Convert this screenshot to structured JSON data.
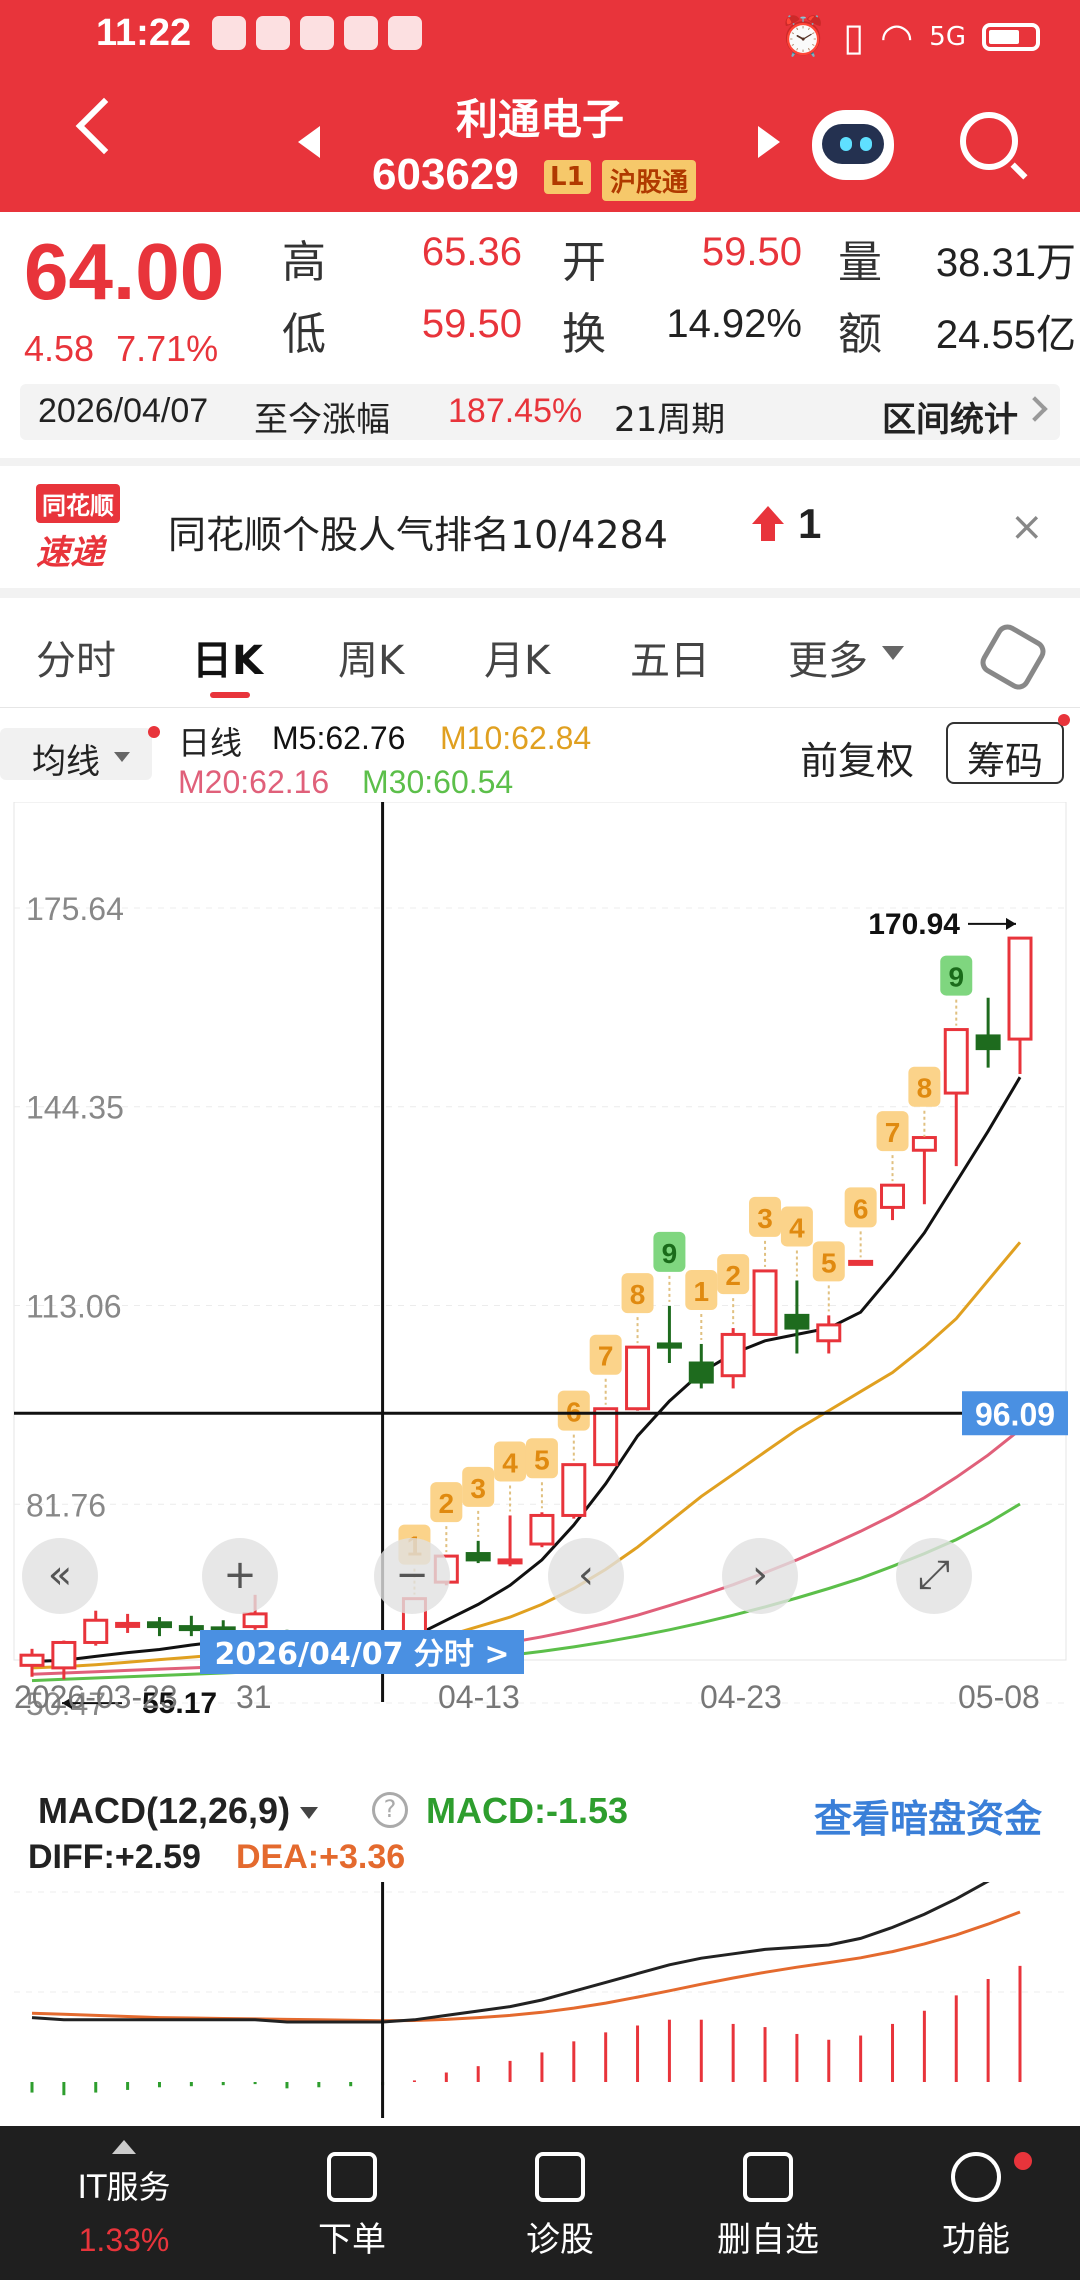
{
  "status": {
    "time": "11:22",
    "network": "5G"
  },
  "header": {
    "name": "利通电子",
    "code": "603629",
    "level_badge": "L1",
    "market_badge": "沪股通"
  },
  "quote": {
    "price": "64.00",
    "change": "4.58",
    "change_pct": "7.71%",
    "high_label": "高",
    "high": "65.36",
    "open_label": "开",
    "open": "59.50",
    "volume_label": "量",
    "volume": "38.31万",
    "low_label": "低",
    "low": "59.50",
    "turnover_label": "换",
    "turnover": "14.92%",
    "amount_label": "额",
    "amount": "24.55亿"
  },
  "stat_bar": {
    "date": "2026/04/07",
    "since_label": "至今涨幅",
    "since_pct": "187.45%",
    "period": "21周期",
    "range_label": "区间统计"
  },
  "rank": {
    "logo_top": "同花顺",
    "logo_bottom": "速递",
    "text": "同花顺个股人气排名10/4284",
    "delta": "1",
    "close": "×"
  },
  "tabs": [
    {
      "label": "分时"
    },
    {
      "label": "日K"
    },
    {
      "label": "周K"
    },
    {
      "label": "月K"
    },
    {
      "label": "五日"
    },
    {
      "label": "更多"
    }
  ],
  "chart_header": {
    "ma_button": "均线",
    "day_line": "日线",
    "m5": "M5:62.76",
    "m10": "M10:62.84",
    "m20": "M20:62.16",
    "m30": "M30:60.54",
    "fuquan": "前复权",
    "chouma": "筹码"
  },
  "colors": {
    "up": "#e8343b",
    "down": "#1e6b1e",
    "m5": "#111111",
    "m10": "#e0a020",
    "m20": "#e0607a",
    "m30": "#5cbf4a",
    "accent_blue": "#3a7fd8"
  },
  "chart_data": {
    "type": "candlestick",
    "y_ticks": [
      "175.64",
      "144.35",
      "113.06",
      "81.76",
      "50.47"
    ],
    "ylim": [
      50.47,
      175.64
    ],
    "x_ticks": [
      "2026-03-23",
      "31",
      "04-13",
      "04-23",
      "05-08"
    ],
    "max_label": "170.94",
    "min_label": "55.17",
    "crosshair_price": "96.09",
    "crosshair_date": "2026/04/07 分时 >",
    "candles": [
      {
        "o": 56.4,
        "h": 59.0,
        "l": 54.6,
        "c": 58.0
      },
      {
        "o": 56.0,
        "h": 60.3,
        "l": 54.2,
        "c": 60.0
      },
      {
        "o": 60.0,
        "h": 65.0,
        "l": 59.5,
        "c": 63.5
      },
      {
        "o": 63.0,
        "h": 64.5,
        "l": 61.5,
        "c": 63.0
      },
      {
        "o": 63.1,
        "h": 64.0,
        "l": 61.0,
        "c": 62.5
      },
      {
        "o": 62.5,
        "h": 64.2,
        "l": 61.0,
        "c": 62.3
      },
      {
        "o": 62.3,
        "h": 63.5,
        "l": 61.0,
        "c": 62.1
      },
      {
        "o": 62.5,
        "h": 67.5,
        "l": 62.0,
        "c": 64.5
      },
      {
        "o": 60.8,
        "h": 62.0,
        "l": 58.5,
        "c": 59.2
      },
      {
        "o": 59.5,
        "h": 60.5,
        "l": 57.5,
        "c": 58.8
      },
      {
        "o": 59.5,
        "h": 61.5,
        "l": 57.5,
        "c": 61.0
      },
      {
        "o": 55.5,
        "h": 62.0,
        "l": 55.2,
        "c": 60.5
      },
      {
        "o": 60.5,
        "h": 66.9,
        "l": 60.5,
        "c": 66.9
      },
      {
        "o": 69.5,
        "h": 73.6,
        "l": 69.0,
        "c": 73.6
      },
      {
        "o": 74.0,
        "h": 76.0,
        "l": 72.5,
        "c": 73.0
      },
      {
        "o": 73.0,
        "h": 80.0,
        "l": 72.0,
        "c": 73.0
      },
      {
        "o": 75.5,
        "h": 80.5,
        "l": 75.0,
        "c": 80.0
      },
      {
        "o": 80.0,
        "h": 88.0,
        "l": 79.5,
        "c": 88.0
      },
      {
        "o": 88.0,
        "h": 96.8,
        "l": 88.0,
        "c": 96.8
      },
      {
        "o": 96.8,
        "h": 106.5,
        "l": 96.5,
        "c": 106.5
      },
      {
        "o": 107.0,
        "h": 113.0,
        "l": 104.0,
        "c": 106.5
      },
      {
        "o": 104.0,
        "h": 107.0,
        "l": 100.0,
        "c": 101.0
      },
      {
        "o": 102.0,
        "h": 109.5,
        "l": 100.0,
        "c": 108.5
      },
      {
        "o": 108.5,
        "h": 118.5,
        "l": 108.5,
        "c": 118.5
      },
      {
        "o": 111.5,
        "h": 117.0,
        "l": 105.5,
        "c": 109.5
      },
      {
        "o": 107.5,
        "h": 111.5,
        "l": 105.5,
        "c": 110.0
      },
      {
        "o": 120.0,
        "h": 120.0,
        "l": 120.0,
        "c": 120.0
      },
      {
        "o": 128.5,
        "h": 132.0,
        "l": 126.5,
        "c": 132.0
      },
      {
        "o": 137.5,
        "h": 139.0,
        "l": 129.0,
        "c": 139.5
      },
      {
        "o": 146.5,
        "h": 156.5,
        "l": 135.0,
        "c": 156.5
      },
      {
        "o": 155.5,
        "h": 161.5,
        "l": 150.5,
        "c": 153.5
      },
      {
        "o": 155.0,
        "h": 170.9,
        "l": 149.5,
        "c": 170.9
      }
    ],
    "td_counts": [
      null,
      null,
      null,
      null,
      null,
      null,
      null,
      null,
      null,
      null,
      null,
      null,
      {
        "n": "1"
      },
      {
        "n": "2"
      },
      {
        "n": "3"
      },
      {
        "n": "4"
      },
      {
        "n": "5"
      },
      {
        "n": "6"
      },
      {
        "n": "7"
      },
      {
        "n": "8"
      },
      {
        "n": "9",
        "green": true
      },
      {
        "n": "1"
      },
      {
        "n": "2"
      },
      {
        "n": "3"
      },
      {
        "n": "4"
      },
      {
        "n": "5"
      },
      {
        "n": "6"
      },
      {
        "n": "7"
      },
      {
        "n": "8"
      },
      {
        "n": "9",
        "green": true
      },
      null,
      null
    ],
    "ma": {
      "m5": [
        57.0,
        57.2,
        57.8,
        58.4,
        58.9,
        59.6,
        60.2,
        60.8,
        60.4,
        59.8,
        59.5,
        59.4,
        61.0,
        63.5,
        66.0,
        69.0,
        73.0,
        78.5,
        85.0,
        92.5,
        98.0,
        102.5,
        105.5,
        107.5,
        108.5,
        109.5,
        112.0,
        118.0,
        124.5,
        132.5,
        140.5,
        149.0
      ],
      "m10": [
        56.0,
        56.2,
        56.5,
        56.9,
        57.3,
        57.7,
        58.1,
        58.5,
        58.8,
        59.0,
        59.2,
        59.4,
        60.0,
        61.0,
        62.5,
        64.0,
        66.0,
        68.5,
        71.5,
        75.0,
        79.0,
        83.0,
        86.5,
        90.0,
        93.5,
        96.5,
        99.5,
        102.5,
        106.5,
        111.0,
        117.0,
        123.0
      ],
      "m20": [
        55.0,
        55.2,
        55.4,
        55.6,
        55.8,
        56.0,
        56.2,
        56.5,
        56.8,
        57.0,
        57.2,
        57.5,
        58.0,
        58.6,
        59.3,
        60.0,
        60.9,
        61.9,
        63.0,
        64.3,
        65.8,
        67.4,
        69.1,
        71.0,
        73.0,
        75.2,
        77.5,
        80.0,
        82.8,
        86.0,
        89.5,
        93.5
      ],
      "m30": [
        54.0,
        54.2,
        54.4,
        54.6,
        54.8,
        55.0,
        55.2,
        55.4,
        55.6,
        55.8,
        56.0,
        56.2,
        56.6,
        57.0,
        57.5,
        58.0,
        58.6,
        59.3,
        60.1,
        61.0,
        62.0,
        63.1,
        64.3,
        65.6,
        67.0,
        68.5,
        70.1,
        72.0,
        74.0,
        76.2,
        78.8,
        81.8
      ]
    },
    "chart_controls": [
      "«",
      "+",
      "−",
      "‹",
      "›",
      "⤢"
    ]
  },
  "macd": {
    "title": "MACD(12,26,9)",
    "value": "MACD:-1.53",
    "link": "查看暗盘资金",
    "diff": "DIFF:+2.59",
    "dea": "DEA:+3.36",
    "chart_data": {
      "type": "line",
      "diff": [
        0.2,
        0.1,
        0.1,
        0.1,
        0.1,
        0.1,
        0.1,
        0.1,
        0.0,
        0.0,
        0.0,
        0.0,
        0.1,
        0.3,
        0.5,
        0.7,
        1.0,
        1.4,
        1.8,
        2.2,
        2.6,
        2.9,
        3.1,
        3.3,
        3.4,
        3.5,
        3.8,
        4.3,
        4.9,
        5.6,
        6.4,
        7.2
      ],
      "dea": [
        0.4,
        0.35,
        0.3,
        0.25,
        0.2,
        0.18,
        0.16,
        0.14,
        0.12,
        0.1,
        0.08,
        0.06,
        0.07,
        0.12,
        0.2,
        0.3,
        0.44,
        0.63,
        0.86,
        1.13,
        1.42,
        1.72,
        2.0,
        2.26,
        2.49,
        2.7,
        2.92,
        3.2,
        3.55,
        3.96,
        4.45,
        5.0
      ],
      "hist": [
        -0.2,
        -0.25,
        -0.2,
        -0.15,
        -0.1,
        -0.08,
        -0.06,
        -0.04,
        -0.12,
        -0.1,
        -0.08,
        -0.06,
        0.03,
        0.18,
        0.3,
        0.4,
        0.56,
        0.77,
        0.94,
        1.07,
        1.18,
        1.18,
        1.1,
        1.04,
        0.91,
        0.8,
        0.88,
        1.1,
        1.35,
        1.64,
        1.95,
        2.2
      ]
    }
  },
  "bottom_nav": {
    "it_label": "IT服务",
    "it_pct": "1.33%",
    "items": [
      {
        "label": "下单"
      },
      {
        "label": "诊股"
      },
      {
        "label": "删自选"
      },
      {
        "label": "功能"
      }
    ]
  }
}
